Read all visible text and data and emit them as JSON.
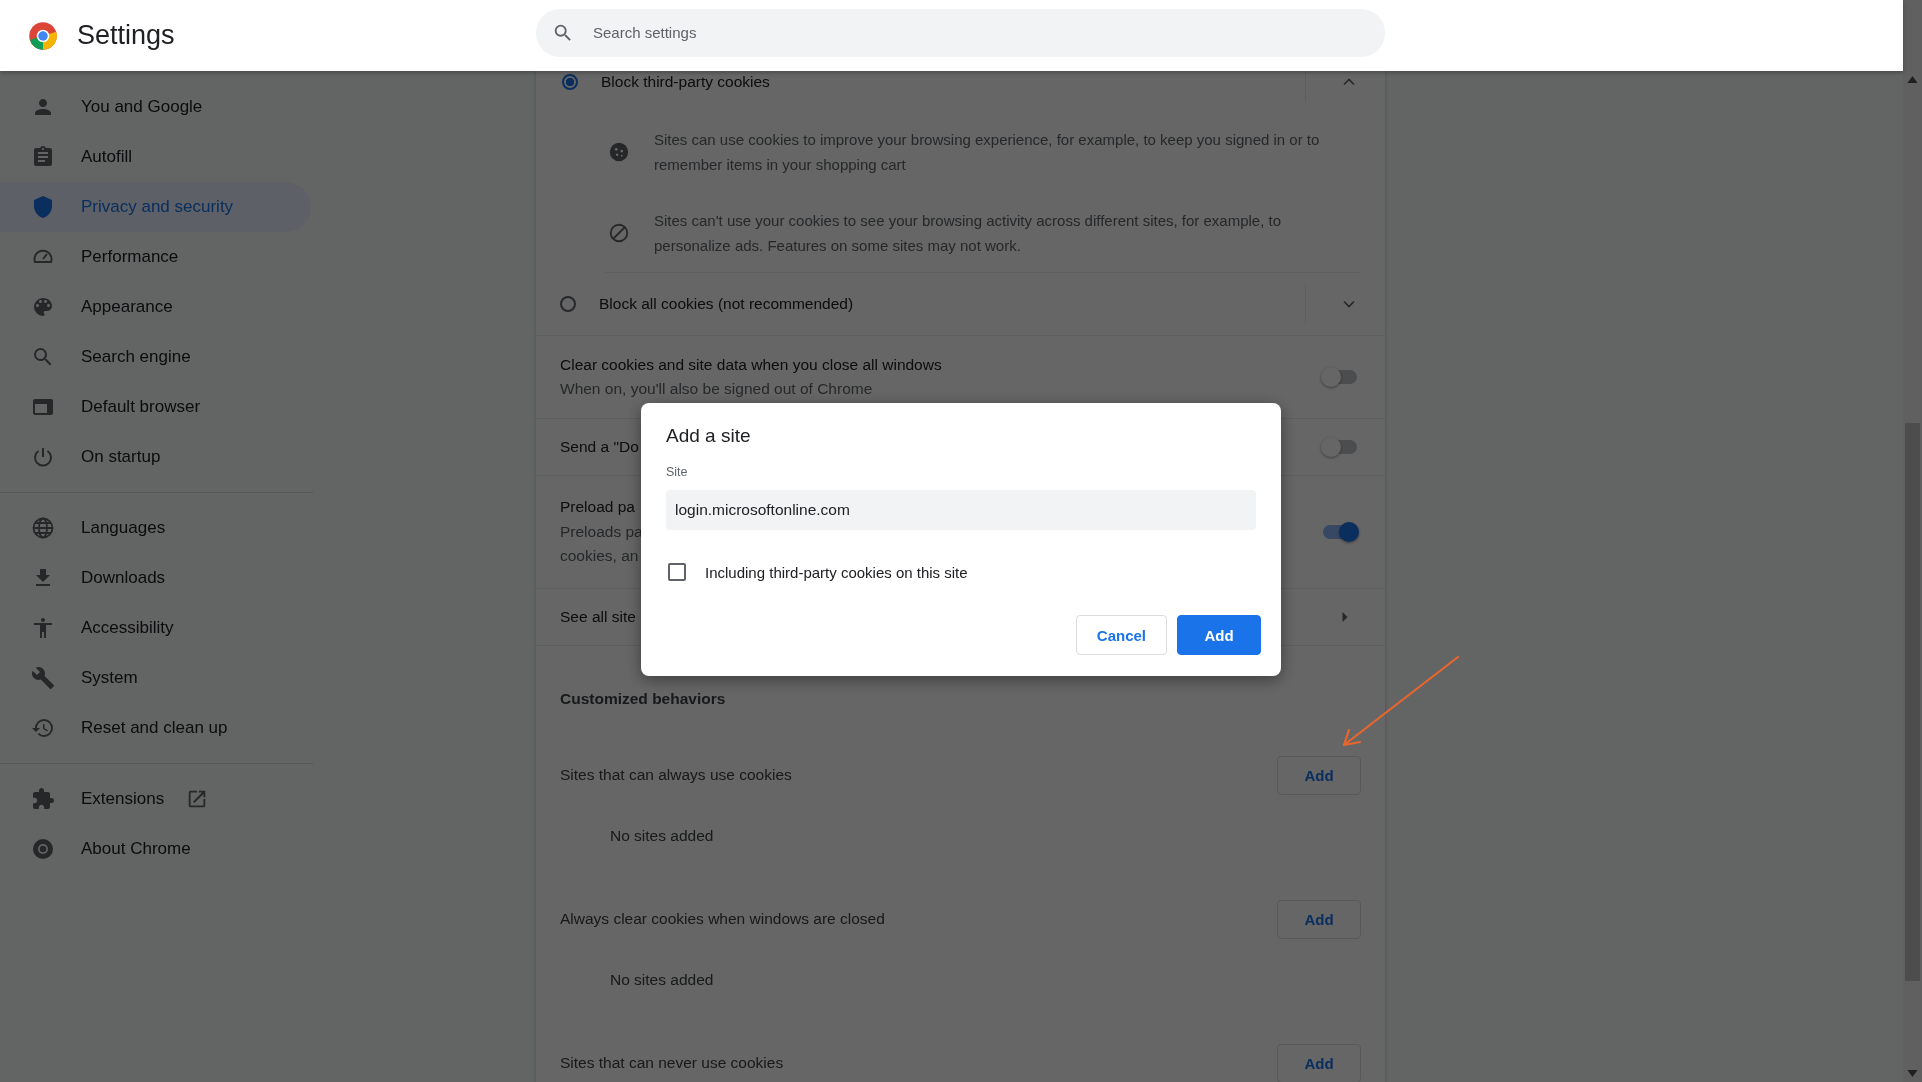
{
  "header": {
    "title": "Settings",
    "search": {
      "placeholder": "Search settings"
    }
  },
  "sidebar": {
    "groups": [
      {
        "items": [
          {
            "label": "You and Google",
            "selected": false
          },
          {
            "label": "Autofill",
            "selected": false
          },
          {
            "label": "Privacy and security",
            "selected": true
          },
          {
            "label": "Performance",
            "selected": false
          },
          {
            "label": "Appearance",
            "selected": false
          },
          {
            "label": "Search engine",
            "selected": false
          },
          {
            "label": "Default browser",
            "selected": false
          },
          {
            "label": "On startup",
            "selected": false
          }
        ]
      },
      {
        "items": [
          {
            "label": "Languages",
            "selected": false
          },
          {
            "label": "Downloads",
            "selected": false
          },
          {
            "label": "Accessibility",
            "selected": false
          },
          {
            "label": "System",
            "selected": false
          },
          {
            "label": "Reset and clean up",
            "selected": false
          }
        ]
      },
      {
        "items": [
          {
            "label": "Extensions",
            "selected": false
          },
          {
            "label": "About Chrome",
            "selected": false
          }
        ]
      }
    ]
  },
  "cookie_options": [
    {
      "label": "Block third-party cookies",
      "selected": true,
      "expanded": true,
      "details": [
        "Sites can use cookies to improve your browsing experience, for example, to keep you signed in or to remember items in your shopping cart",
        "Sites can't use your cookies to see your browsing activity across different sites, for example, to personalize ads. Features on some sites may not work."
      ]
    },
    {
      "label": "Block all cookies (not recommended)",
      "selected": false,
      "expanded": false
    }
  ],
  "settings": [
    {
      "kind": "toggle",
      "title": "Clear cookies and site data when you close all windows",
      "subtitle_lines": [
        "When on, you'll also be signed out of Chrome"
      ],
      "on": false
    },
    {
      "kind": "toggle",
      "title": "Send a \"Do",
      "on": false
    },
    {
      "kind": "toggle",
      "title": "Preload pa",
      "subtitle_lines": [
        "Preloads pa",
        "cookies, an"
      ],
      "on": true
    },
    {
      "kind": "link",
      "title": "See all site"
    }
  ],
  "customized": {
    "heading": "Customized behaviors",
    "lists": [
      {
        "title": "Sites that can always use cookies",
        "button": "Add",
        "empty": "No sites added"
      },
      {
        "title": "Always clear cookies when windows are closed",
        "button": "Add",
        "empty": "No sites added"
      },
      {
        "title": "Sites that can never use cookies",
        "button": "Add"
      }
    ]
  },
  "dialog": {
    "title": "Add a site",
    "field_label": "Site",
    "value": "login.microsoftonline.com",
    "checkbox": {
      "label": "Including third-party cookies on this site",
      "checked": false
    },
    "buttons": [
      {
        "label": "Cancel",
        "kind": "secondary"
      },
      {
        "label": "Add",
        "kind": "primary"
      }
    ]
  }
}
